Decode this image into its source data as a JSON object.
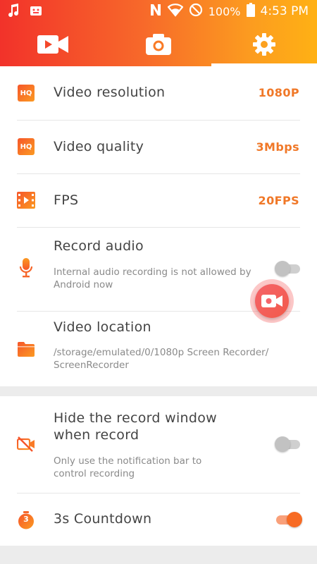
{
  "status_bar": {
    "battery": "100%",
    "time": "4:53 PM",
    "icons": [
      "music-note-icon",
      "android-icon",
      "nfc-icon",
      "wifi-icon",
      "do-not-disturb-icon",
      "battery-icon"
    ]
  },
  "tabs": [
    {
      "name": "video-camera-icon",
      "active": false
    },
    {
      "name": "camera-icon",
      "active": false
    },
    {
      "name": "gear-icon",
      "active": true
    }
  ],
  "settings": {
    "resolution": {
      "title": "Video resolution",
      "value": "1080P",
      "icon": "hq-icon"
    },
    "quality": {
      "title": "Video quality",
      "value": "3Mbps",
      "icon": "hq-icon"
    },
    "fps": {
      "title": "FPS",
      "value": "20FPS",
      "icon": "film-icon"
    },
    "record_audio": {
      "title": "Record audio",
      "sub_line1": "Internal audio recording is not allowed by",
      "sub_line2": "Android now",
      "enabled": false,
      "icon": "microphone-icon"
    },
    "location": {
      "title": "Video location",
      "sub_line1": "/storage/emulated/0/1080p Screen Recorder/",
      "sub_line2": "ScreenRecorder",
      "icon": "folder-icon"
    },
    "hide_window": {
      "title_line1": "Hide the record window",
      "title_line2": "when record",
      "sub_line1": "Only use the notification bar to",
      "sub_line2": "control recording",
      "enabled": false,
      "icon": "camera-off-icon"
    },
    "countdown": {
      "title": "3s Countdown",
      "badge": "3",
      "enabled": true,
      "icon": "timer-icon"
    }
  },
  "colors": {
    "accent": "#f07828",
    "gradient_start": "#f2322a",
    "gradient_end": "#ffb114",
    "fab": "#f5646a"
  }
}
